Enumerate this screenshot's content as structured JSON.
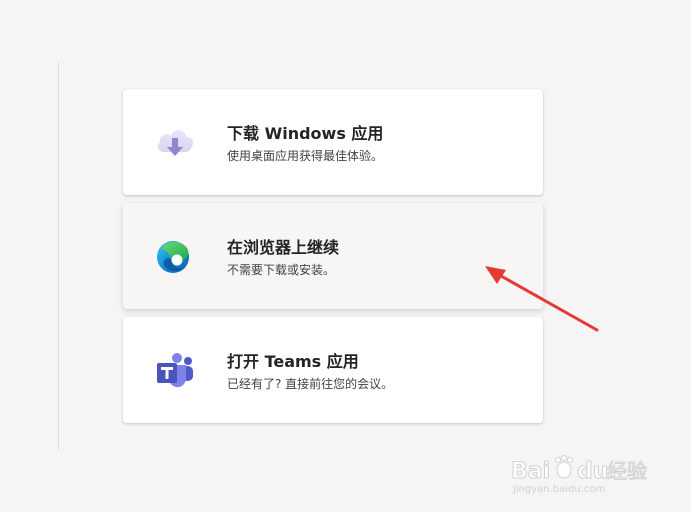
{
  "cards": [
    {
      "title": "下载 Windows 应用",
      "subtitle": "使用桌面应用获得最佳体验。",
      "icon": "cloud-download-icon"
    },
    {
      "title": "在浏览器上继续",
      "subtitle": "不需要下载或安装。",
      "icon": "edge-browser-icon"
    },
    {
      "title": "打开 Teams 应用",
      "subtitle": "已经有了? 直接前往您的会议。",
      "icon": "teams-icon"
    }
  ],
  "annotation": {
    "arrow_color": "#e53935"
  },
  "watermark": {
    "logo_text": "Baidu经验",
    "url_text": "jingyan.baidu.com"
  },
  "colors": {
    "background": "#f5f5f5",
    "card": "#ffffff",
    "card_hover": "#f7f6f5",
    "teams_purple": "#5b5fc7"
  }
}
